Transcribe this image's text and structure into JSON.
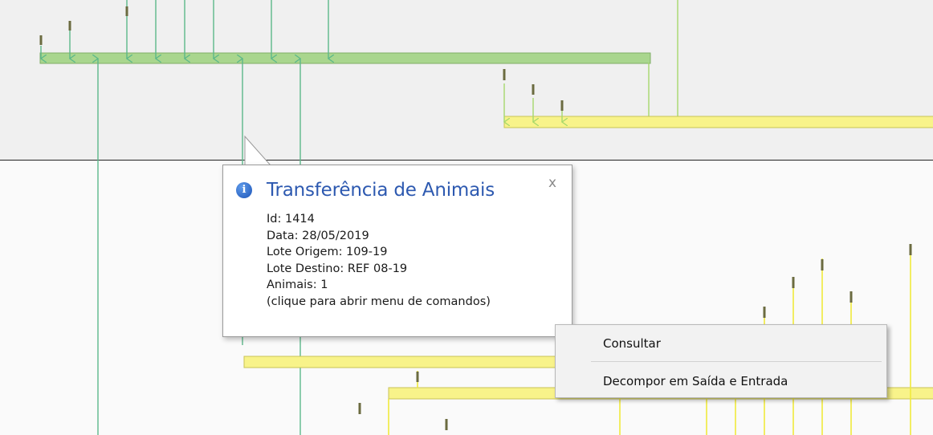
{
  "tooltip": {
    "title": "Transferência de Animais",
    "icon": "info-icon",
    "close_label": "x",
    "lines": {
      "id": "Id: 1414",
      "data": "Data: 28/05/2019",
      "lote_origem": "Lote Origem: 109-19",
      "lote_destino": "Lote Destino: REF 08-19",
      "animais": "Animais: 1",
      "hint": "(clique para abrir menu de comandos)"
    }
  },
  "context_menu": {
    "items": [
      {
        "label": "Consultar"
      },
      {
        "label": "Decompor em Saída e Entrada"
      }
    ]
  },
  "colors": {
    "green_bar": "#a9d68e",
    "green_line": "#5cb88a",
    "yellow_bar": "#f8f38a",
    "yellow_line": "#f0ea3c",
    "light_green_line": "#a6d86c",
    "tick_mark": "#6b6b40",
    "title_blue": "#2d59b0"
  }
}
